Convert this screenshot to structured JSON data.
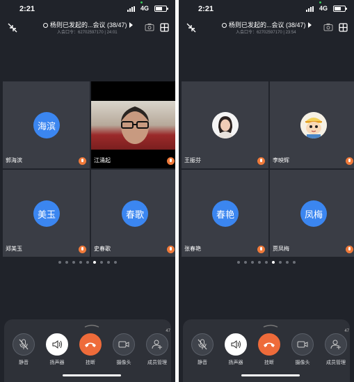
{
  "phones": [
    {
      "status": {
        "time": "2:21",
        "network": "4G"
      },
      "meeting": {
        "title": "杨则已发起的...会议 (38/47)",
        "subtitle": "入会口令：62702597170 | 24:01"
      },
      "participants": [
        {
          "name": "郭海滨",
          "avatar_text": "海滨",
          "type": "initials"
        },
        {
          "name": "江涌起",
          "avatar_text": "",
          "type": "video"
        },
        {
          "name": "郑美玉",
          "avatar_text": "美玉",
          "type": "initials"
        },
        {
          "name": "史春歌",
          "avatar_text": "春歌",
          "type": "initials"
        }
      ],
      "page_dots": {
        "count": 9,
        "active": 5
      },
      "controls": [
        {
          "label": "静音",
          "icon": "mic-muted-icon"
        },
        {
          "label": "扬声器",
          "icon": "speaker-icon"
        },
        {
          "label": "挂断",
          "icon": "hangup-icon"
        },
        {
          "label": "摄像头",
          "icon": "camera-icon"
        },
        {
          "label": "成员管理",
          "icon": "members-icon",
          "badge": "47"
        }
      ]
    },
    {
      "status": {
        "time": "2:21",
        "network": "4G"
      },
      "meeting": {
        "title": "杨则已发起的...会议 (38/47)",
        "subtitle": "入会口令：62702597170 | 23:54"
      },
      "participants": [
        {
          "name": "王振芬",
          "avatar_text": "",
          "type": "photo-woman"
        },
        {
          "name": "李映辉",
          "avatar_text": "",
          "type": "photo-cartoon"
        },
        {
          "name": "张春艳",
          "avatar_text": "春艳",
          "type": "initials"
        },
        {
          "name": "贾凤梅",
          "avatar_text": "凤梅",
          "type": "initials"
        }
      ],
      "page_dots": {
        "count": 9,
        "active": 5
      },
      "controls": [
        {
          "label": "静音",
          "icon": "mic-muted-icon"
        },
        {
          "label": "扬声器",
          "icon": "speaker-icon"
        },
        {
          "label": "挂断",
          "icon": "hangup-icon"
        },
        {
          "label": "摄像头",
          "icon": "camera-icon"
        },
        {
          "label": "成员管理",
          "icon": "members-icon",
          "badge": "47"
        }
      ]
    }
  ],
  "colors": {
    "avatar_blue": "#3b86f0",
    "hangup": "#ee6b3a",
    "background": "#20232a"
  }
}
